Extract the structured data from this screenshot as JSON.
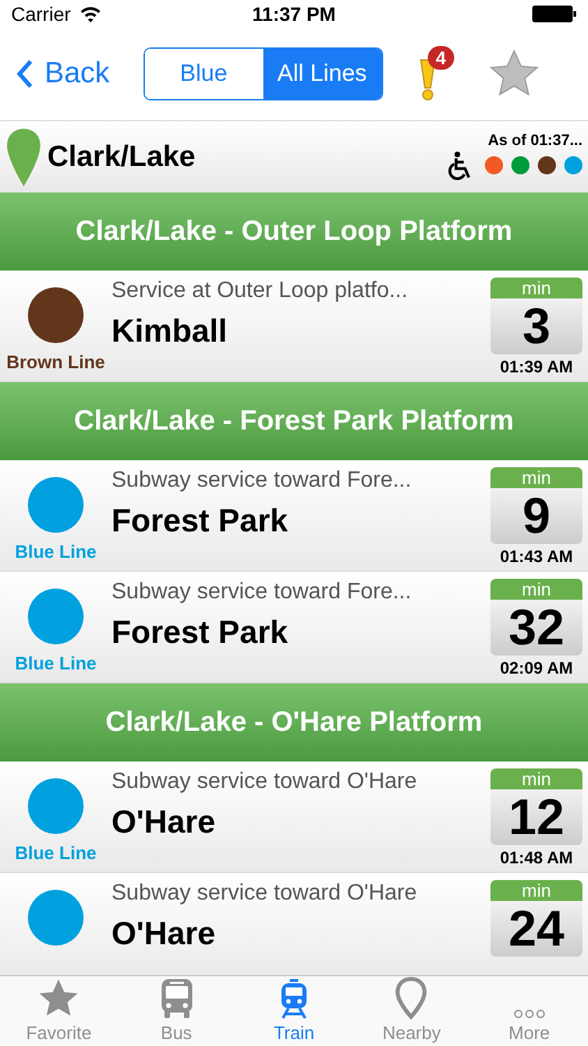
{
  "status_bar": {
    "carrier": "Carrier",
    "time": "11:37 PM"
  },
  "nav": {
    "back": "Back",
    "segments": [
      {
        "label": "Blue",
        "selected": false
      },
      {
        "label": "All Lines",
        "selected": true
      }
    ],
    "alert_count": "4"
  },
  "station": {
    "name": "Clark/Lake",
    "as_of": "As of 01:37...",
    "accessible": true,
    "lines": [
      {
        "color": "#f15a24"
      },
      {
        "color": "#009b3a"
      },
      {
        "color": "#62361b"
      },
      {
        "color": "#00a1de"
      }
    ]
  },
  "sections": [
    {
      "title": "Clark/Lake - Outer Loop Platform",
      "arrivals": [
        {
          "color": "#62361b",
          "line": "Brown Line",
          "description": "Service at Outer Loop platfo...",
          "destination": "Kimball",
          "unit": "min",
          "minutes": "3",
          "time": "01:39 AM"
        }
      ]
    },
    {
      "title": "Clark/Lake - Forest Park Platform",
      "arrivals": [
        {
          "color": "#00a1de",
          "line": "Blue Line",
          "description": "Subway service toward Fore...",
          "destination": "Forest Park",
          "unit": "min",
          "minutes": "9",
          "time": "01:43 AM"
        },
        {
          "color": "#00a1de",
          "line": "Blue Line",
          "description": "Subway service toward Fore...",
          "destination": "Forest Park",
          "unit": "min",
          "minutes": "32",
          "time": "02:09 AM"
        }
      ]
    },
    {
      "title": "Clark/Lake - O'Hare Platform",
      "arrivals": [
        {
          "color": "#00a1de",
          "line": "Blue Line",
          "description": "Subway service toward O'Hare",
          "destination": "O'Hare",
          "unit": "min",
          "minutes": "12",
          "time": "01:48 AM"
        },
        {
          "color": "#00a1de",
          "description": "Subway service toward O'Hare",
          "destination": "O'Hare",
          "unit": "min",
          "minutes": "24"
        }
      ]
    }
  ],
  "tab_bar": [
    {
      "kind": "star",
      "label": "Favorite",
      "selected": false
    },
    {
      "kind": "bus",
      "label": "Bus",
      "selected": false
    },
    {
      "kind": "train",
      "label": "Train",
      "selected": true
    },
    {
      "kind": "pin",
      "label": "Nearby",
      "selected": false
    },
    {
      "kind": "more",
      "label": "More",
      "selected": false
    }
  ]
}
